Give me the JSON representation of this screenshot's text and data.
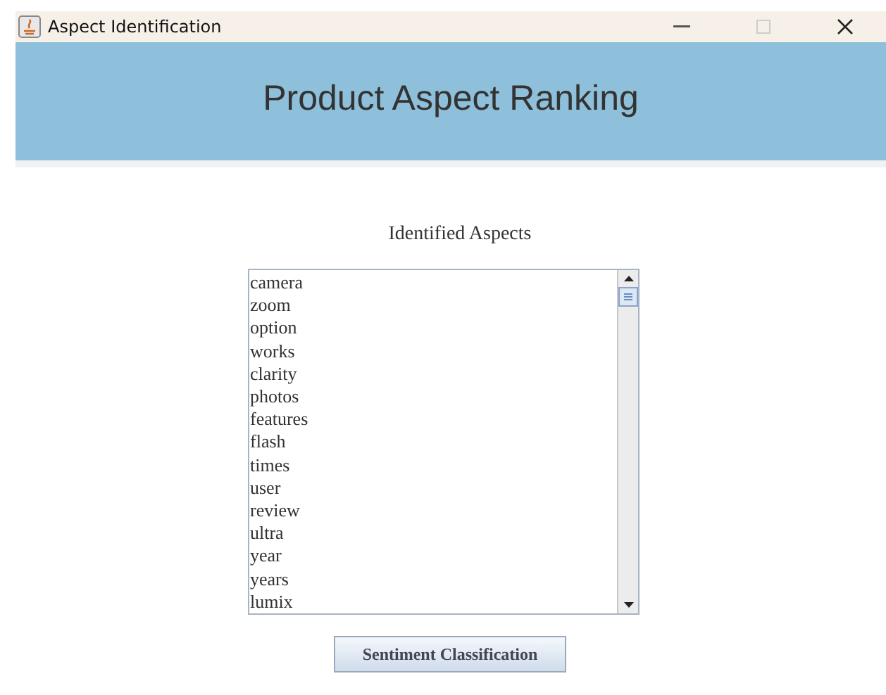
{
  "window": {
    "title": "Aspect Identification"
  },
  "banner": {
    "title": "Product Aspect Ranking"
  },
  "aspects": {
    "label": "Identified Aspects",
    "items": [
      "camera",
      "zoom",
      "option",
      "works",
      "clarity",
      "photos",
      "features",
      "flash",
      "times",
      "user",
      "review",
      "ultra",
      "year",
      "years",
      "lumix"
    ]
  },
  "buttons": [
    "Sentiment Classification"
  ]
}
